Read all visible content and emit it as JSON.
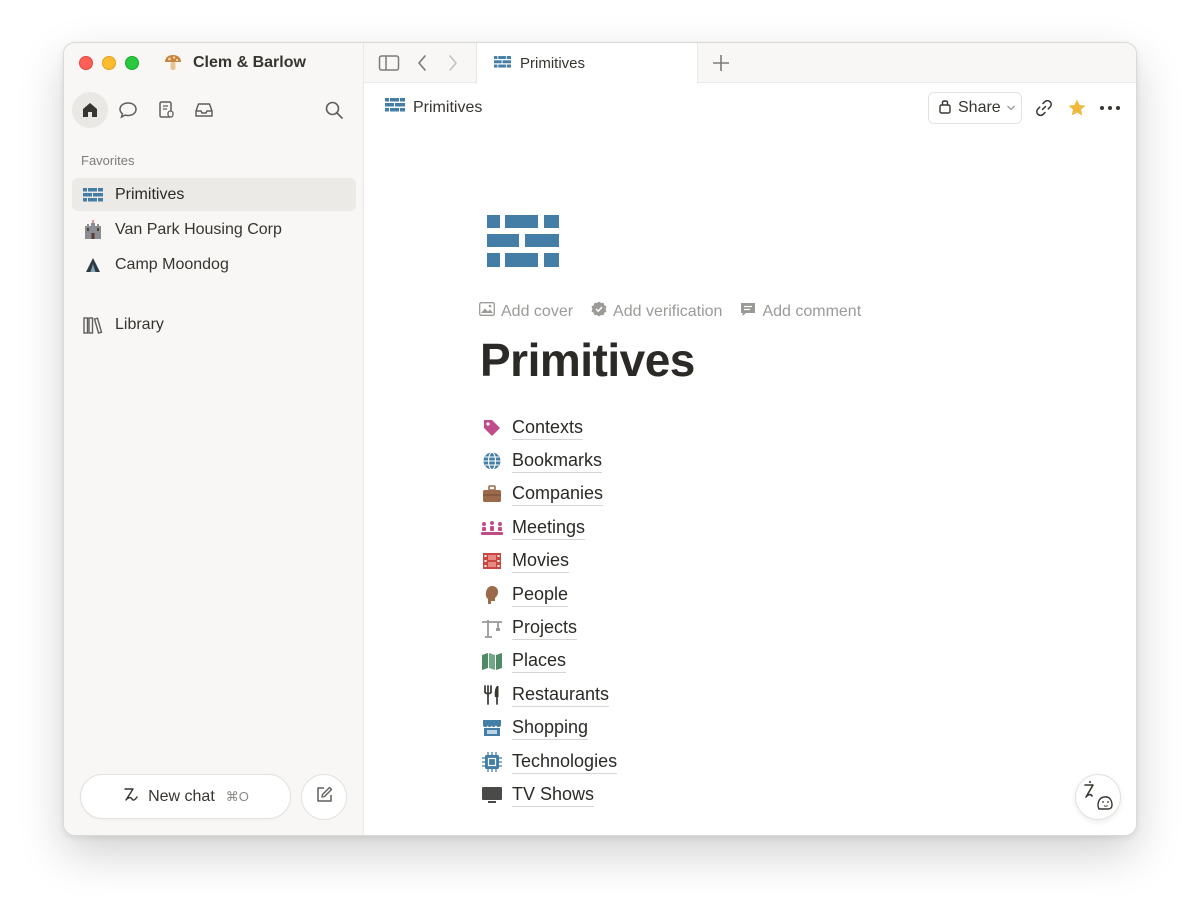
{
  "window": {
    "traffic_lights": [
      "close",
      "minimize",
      "zoom"
    ]
  },
  "sidebar": {
    "workspace_name": "Clem & Barlow",
    "workspace_icon": "mushroom-icon",
    "tools": [
      "home-icon",
      "chat-bubble-icon",
      "meeting-notes-icon",
      "inbox-icon",
      "search-icon"
    ],
    "section_label": "Favorites",
    "favorites": [
      {
        "label": "Primitives",
        "icon": "bricks-icon",
        "selected": true
      },
      {
        "label": "Van Park Housing Corp",
        "icon": "castle-icon",
        "selected": false
      },
      {
        "label": "Camp Moondog",
        "icon": "tent-icon",
        "selected": false
      }
    ],
    "library_label": "Library",
    "new_chat_label": "New chat",
    "new_chat_shortcut": "⌘O"
  },
  "tabbar": {
    "active_tab_label": "Primitives"
  },
  "topbar": {
    "breadcrumb": "Primitives",
    "share_label": "Share"
  },
  "page": {
    "actions": [
      "Add cover",
      "Add verification",
      "Add comment"
    ],
    "title": "Primitives",
    "links": [
      {
        "label": "Contexts",
        "icon": "tag-icon"
      },
      {
        "label": "Bookmarks",
        "icon": "globe-icon"
      },
      {
        "label": "Companies",
        "icon": "briefcase-icon"
      },
      {
        "label": "Meetings",
        "icon": "meeting-icon"
      },
      {
        "label": "Movies",
        "icon": "film-icon"
      },
      {
        "label": "People",
        "icon": "person-head-icon"
      },
      {
        "label": "Projects",
        "icon": "crane-icon"
      },
      {
        "label": "Places",
        "icon": "map-icon"
      },
      {
        "label": "Restaurants",
        "icon": "fork-knife-icon"
      },
      {
        "label": "Shopping",
        "icon": "storefront-icon"
      },
      {
        "label": "Technologies",
        "icon": "chip-icon"
      },
      {
        "label": "TV Shows",
        "icon": "tv-icon"
      }
    ]
  },
  "colors": {
    "accent_blue": "#447ea6",
    "star": "#f0b93b",
    "sidebar_bg": "#f8f7f5"
  }
}
